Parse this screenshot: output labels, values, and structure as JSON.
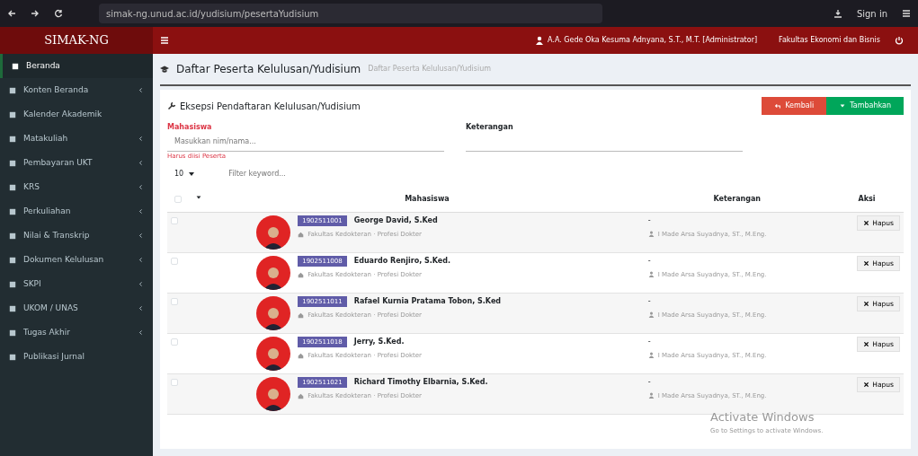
{
  "browser": {
    "url": "simak-ng.unud.ac.id/yudisium/pesertaYudisium",
    "sign_in": "Sign in"
  },
  "app": {
    "brand": "SIMAK-NG",
    "user": "A.A. Gede Oka Kesuma Adnyana, S.T., M.T. [Administrator]",
    "unit": "Fakultas Ekonomi dan Bisnis"
  },
  "sidebar": {
    "items": [
      {
        "label": "Beranda",
        "selected": true,
        "expandable": false
      },
      {
        "label": "Konten Beranda",
        "selected": false,
        "expandable": true
      },
      {
        "label": "Kalender Akademik",
        "selected": false,
        "expandable": false
      },
      {
        "label": "Matakuliah",
        "selected": false,
        "expandable": true
      },
      {
        "label": "Pembayaran UKT",
        "selected": false,
        "expandable": true
      },
      {
        "label": "KRS",
        "selected": false,
        "expandable": true
      },
      {
        "label": "Perkuliahan",
        "selected": false,
        "expandable": true
      },
      {
        "label": "Nilai & Transkrip",
        "selected": false,
        "expandable": true
      },
      {
        "label": "Dokumen Kelulusan",
        "selected": false,
        "expandable": true
      },
      {
        "label": "SKPI",
        "selected": false,
        "expandable": true
      },
      {
        "label": "UKOM / UNAS",
        "selected": false,
        "expandable": true
      },
      {
        "label": "Tugas Akhir",
        "selected": false,
        "expandable": true
      },
      {
        "label": "Publikasi Jurnal",
        "selected": false,
        "expandable": false
      }
    ]
  },
  "page": {
    "title": "Daftar Peserta Kelulusan/Yudisium",
    "subtitle": "Daftar Peserta Kelulusan/Yudisium"
  },
  "card": {
    "title": "Eksepsi Pendaftaran Kelulusan/Yudisium",
    "buttons": [
      {
        "label": "Kembali",
        "kind": "back"
      },
      {
        "label": "Tambahkan",
        "kind": "add"
      }
    ],
    "form": {
      "student_label": "Mahasiswa",
      "student_placeholder": "Masukkan nim/nama...",
      "note_label": "Keterangan",
      "error": "Harus diisi Peserta"
    },
    "page_length": "10",
    "filter_placeholder": "Filter keyword..."
  },
  "table": {
    "select_all_checked": false,
    "columns": [
      "Mahasiswa",
      "Keterangan",
      "Aksi"
    ],
    "rows": [
      {
        "checked": false,
        "nim": "1902511001",
        "name": "George David, S.Ked",
        "program": "Fakultas Kedokteran · Profesi Dokter",
        "note": "-",
        "officer": "I Made Arsa Suyadnya, ST., M.Eng.",
        "action": "Hapus"
      },
      {
        "checked": false,
        "nim": "1902511008",
        "name": "Eduardo Renjiro, S.Ked.",
        "program": "Fakultas Kedokteran · Profesi Dokter",
        "note": "-",
        "officer": "I Made Arsa Suyadnya, ST., M.Eng.",
        "action": "Hapus"
      },
      {
        "checked": false,
        "nim": "1902511011",
        "name": "Rafael Kurnia Pratama Tobon, S.Ked",
        "program": "Fakultas Kedokteran · Profesi Dokter",
        "note": "-",
        "officer": "I Made Arsa Suyadnya, ST., M.Eng.",
        "action": "Hapus"
      },
      {
        "checked": false,
        "nim": "1902511018",
        "name": "Jerry, S.Ked.",
        "program": "Fakultas Kedokteran · Profesi Dokter",
        "note": "-",
        "officer": "I Made Arsa Suyadnya, ST., M.Eng.",
        "action": "Hapus"
      },
      {
        "checked": false,
        "nim": "1902511021",
        "name": "Richard Timothy Elbarnia, S.Ked.",
        "program": "Fakultas Kedokteran · Profesi Dokter",
        "note": "-",
        "officer": "I Made Arsa Suyadnya, ST., M.Eng.",
        "action": "Hapus"
      }
    ]
  },
  "os_notice": {
    "title": "Activate Windows",
    "text": "Go to Settings to activate Windows."
  }
}
